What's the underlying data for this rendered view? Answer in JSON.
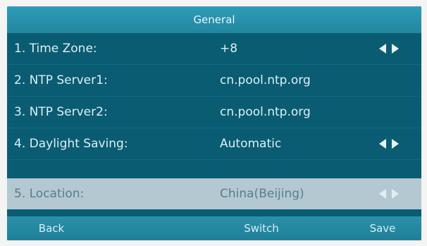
{
  "title": "General",
  "rows": [
    {
      "label": "1. Time Zone:",
      "value": "+8",
      "has_arrows": true
    },
    {
      "label": "2. NTP Server1:",
      "value": "cn.pool.ntp.org",
      "has_arrows": false
    },
    {
      "label": "3. NTP Server2:",
      "value": "cn.pool.ntp.org",
      "has_arrows": false
    },
    {
      "label": "4. Daylight Saving:",
      "value": "Automatic",
      "has_arrows": true
    },
    {
      "label": "5. Location:",
      "value": "China(Beijing)",
      "has_arrows": true,
      "selected": true
    }
  ],
  "softkeys": {
    "back": "Back",
    "switch": "Switch",
    "save": "Save"
  },
  "colors": {
    "screen_bg": "#0a5c72",
    "title_bg": "#2a93ae",
    "selected_row_bg": "#b4c8d2"
  }
}
